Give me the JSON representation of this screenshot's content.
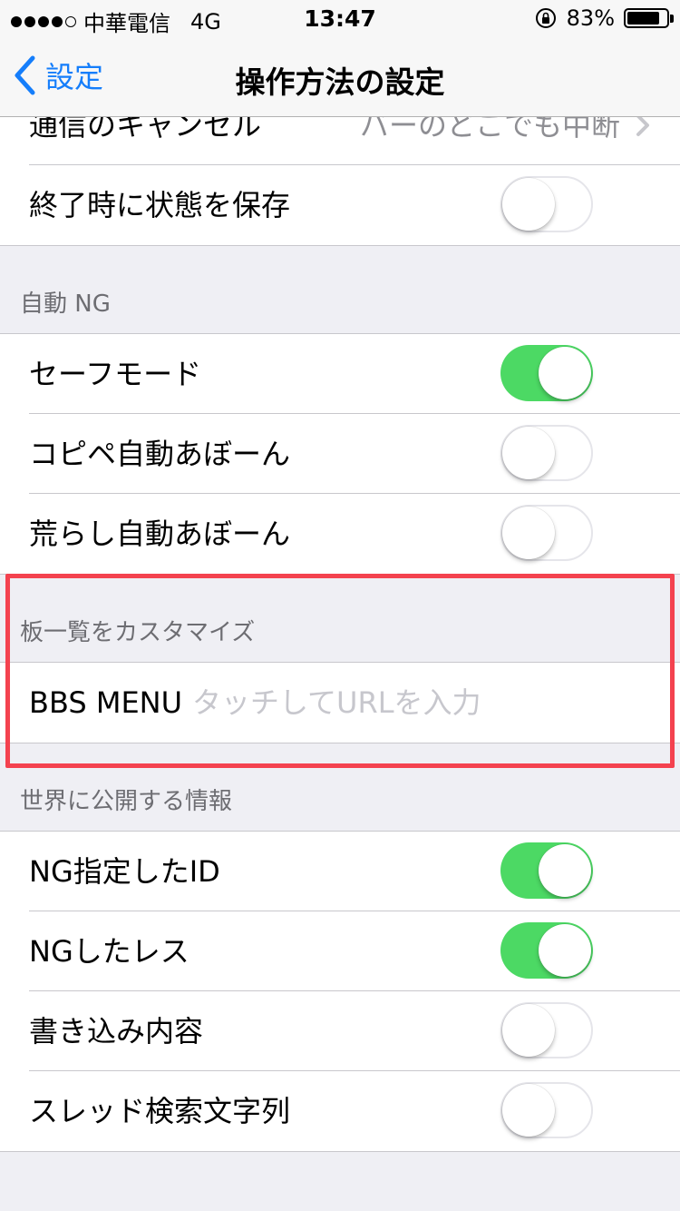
{
  "status_bar": {
    "carrier": "中華電信",
    "network": "4G",
    "time": "13:47",
    "battery": "83%",
    "battery_level": 0.83
  },
  "nav": {
    "back_label": "設定",
    "title": "操作方法の設定"
  },
  "top_rows": {
    "cancel": {
      "label": "通信のキャンセル",
      "value": "バーのどこでも中断"
    },
    "save_state": {
      "label": "終了時に状態を保存",
      "on": false
    }
  },
  "auto_ng": {
    "header": "自動 NG",
    "safe_mode": {
      "label": "セーフモード",
      "on": true
    },
    "copipe": {
      "label": "コピペ自動あぼーん",
      "on": false
    },
    "arashi": {
      "label": "荒らし自動あぼーん",
      "on": false
    }
  },
  "board_list": {
    "header": "板一覧をカスタマイズ",
    "bbs_menu_label": "BBS MENU",
    "url_placeholder": "タッチしてURLを入力",
    "url_value": ""
  },
  "public_info": {
    "header": "世界に公開する情報",
    "ng_id": {
      "label": "NG指定したID",
      "on": true
    },
    "ng_res": {
      "label": "NGしたレス",
      "on": true
    },
    "post_content": {
      "label": "書き込み内容",
      "on": false
    },
    "thread_search": {
      "label": "スレッド検索文字列",
      "on": false
    }
  },
  "colors": {
    "accent": "#157efb",
    "toggle_on": "#4cd964",
    "highlight": "#f4424f"
  }
}
